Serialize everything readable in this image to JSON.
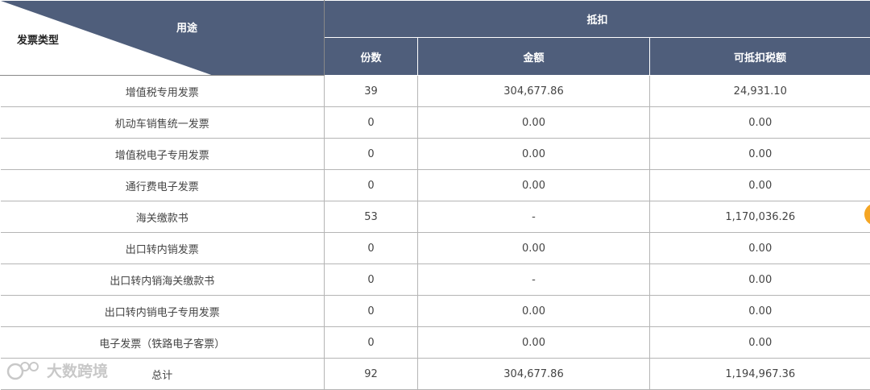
{
  "header": {
    "corner_top_label": "用途",
    "corner_bottom_label": "发票类型",
    "group_label": "抵扣",
    "columns": [
      "份数",
      "金额",
      "可抵扣税额"
    ]
  },
  "rows": [
    {
      "type": "增值税专用发票",
      "count": "39",
      "amount": "304,677.86",
      "tax": "24,931.10"
    },
    {
      "type": "机动车销售统一发票",
      "count": "0",
      "amount": "0.00",
      "tax": "0.00"
    },
    {
      "type": "增值税电子专用发票",
      "count": "0",
      "amount": "0.00",
      "tax": "0.00"
    },
    {
      "type": "通行费电子发票",
      "count": "0",
      "amount": "0.00",
      "tax": "0.00"
    },
    {
      "type": "海关缴款书",
      "count": "53",
      "amount": "-",
      "tax": "1,170,036.26"
    },
    {
      "type": "出口转内销发票",
      "count": "0",
      "amount": "0.00",
      "tax": "0.00"
    },
    {
      "type": "出口转内销海关缴款书",
      "count": "0",
      "amount": "-",
      "tax": "0.00"
    },
    {
      "type": "出口转内销电子专用发票",
      "count": "0",
      "amount": "0.00",
      "tax": "0.00"
    },
    {
      "type": "电子发票（铁路电子客票）",
      "count": "0",
      "amount": "0.00",
      "tax": "0.00"
    },
    {
      "type": "总计",
      "count": "92",
      "amount": "304,677.86",
      "tax": "1,194,967.36"
    }
  ],
  "watermark": {
    "text": "大数跨境"
  },
  "colors": {
    "header_bg": "#4f5e7b",
    "accent": "#f5a623"
  }
}
